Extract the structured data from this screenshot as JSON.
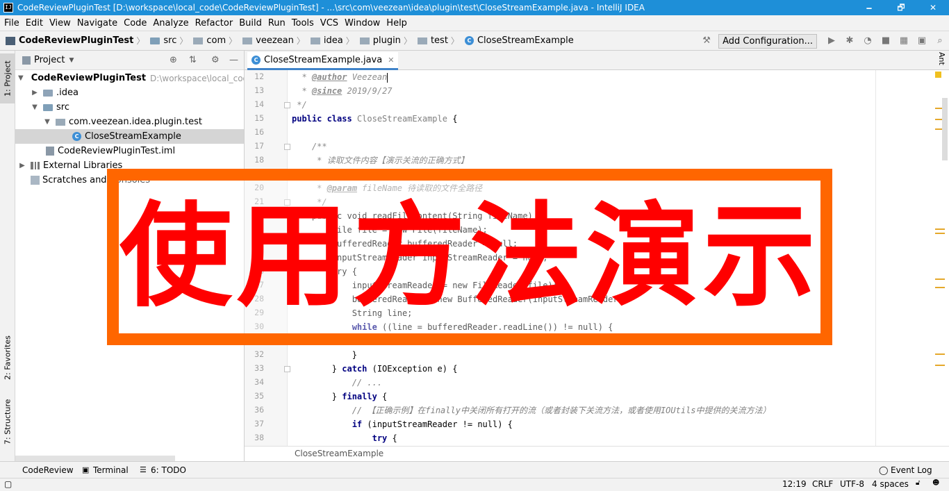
{
  "window": {
    "app_icon": "IJ",
    "title": "CodeReviewPluginTest [D:\\workspace\\local_code\\CodeReviewPluginTest] - ...\\src\\com\\veezean\\idea\\plugin\\test\\CloseStreamExample.java - IntelliJ IDEA",
    "minimize": "🗕",
    "maximize": "🗗",
    "close": "✕"
  },
  "menu": [
    "File",
    "Edit",
    "View",
    "Navigate",
    "Code",
    "Analyze",
    "Refactor",
    "Build",
    "Run",
    "Tools",
    "VCS",
    "Window",
    "Help"
  ],
  "breadcrumbs": [
    "CodeReviewPluginTest",
    "src",
    "com",
    "veezean",
    "idea",
    "plugin",
    "test",
    "CloseStreamExample"
  ],
  "toolbar": {
    "add_configuration": "Add Configuration..."
  },
  "left_strip": {
    "project_tab": "1: Project",
    "favorites_tab": "2: Favorites",
    "structure_tab": "7: Structure"
  },
  "project_panel": {
    "title": "Project",
    "tree": [
      {
        "label": "CodeReviewPluginTest",
        "extra": "D:\\workspace\\local_code"
      },
      {
        "label": ".idea"
      },
      {
        "label": "src"
      },
      {
        "label": "com.veezean.idea.plugin.test"
      },
      {
        "label": "CloseStreamExample"
      },
      {
        "label": "CodeReviewPluginTest.iml"
      },
      {
        "label": "External Libraries"
      },
      {
        "label": "Scratches and Consoles"
      }
    ]
  },
  "editor": {
    "tab_label": "CloseStreamExample.java",
    "line_numbers": [
      "12",
      "13",
      "14",
      "15",
      "16",
      "17",
      "18",
      "",
      "20",
      "21",
      "22",
      "23",
      "24",
      "25",
      "26",
      "27",
      "28",
      "29",
      "30",
      "",
      "32",
      "33",
      "34",
      "35",
      "36",
      "37",
      "38"
    ],
    "lines": {
      "l12_tag": "@author",
      "l12_text": " Veezean",
      "l13_tag": "@since",
      "l13_text": " 2019/9/27",
      "l14": " */",
      "l15_kw": "public class ",
      "l15_cls": "CloseStreamExample",
      "l15_rest": " {",
      "l17": "    /**",
      "l18": "     * 读取文件内容【演示关流的正确方式】",
      "l20_pre": "     * ",
      "l20_tag": "@param",
      "l20_rest": " fileName 待读取的文件全路径",
      "l21": "     */",
      "l22": "    public void readFileContent(String fileName) {",
      "l23": "        File file = new File(fileName);",
      "l24": "        BufferedReader bufferedReader = null;",
      "l25": "        InputStreamReader inputStreamReader = null;",
      "l26": "        try {",
      "l27": "            inputStreamReader = new FileReader(file);",
      "l28": "            bufferedReader = new BufferedReader(inputStreamReader);",
      "l29": "            String line;",
      "l30_kw": "            while",
      "l30_rest": " ((line = bufferedReader.readLine()) != null) {",
      "l32": "            }",
      "l33_pre": "        } ",
      "l33_kw": "catch",
      "l33_rest": " (IOException e) {",
      "l34": "            // ...",
      "l35_pre": "        } ",
      "l35_kw": "finally",
      "l35_rest": " {",
      "l36": "            // 【正确示例】在finally中关闭所有打开的流（或者封装下关流方法，或者使用IOUtils中提供的关流方法）",
      "l37_kw": "            if",
      "l37_rest": " (inputStreamReader != null) {",
      "l38_kw": "                try",
      "l38_rest": " {"
    },
    "breadcrumb": "CloseStreamExample"
  },
  "overlay_text": "使用方法演示",
  "right_strip": {
    "ant_tab": "Ant"
  },
  "bottom_tools": {
    "code_review": "CodeReview",
    "terminal": "Terminal",
    "todo": "6: TODO",
    "event_log": "Event Log"
  },
  "status": {
    "position": "12:19",
    "line_sep": "CRLF",
    "encoding": "UTF-8",
    "indent": "4 spaces"
  },
  "colors": {
    "titlebar": "#1e8fd8",
    "overlay_border": "#ff6600",
    "overlay_text": "#ff0000",
    "keyword": "#000080"
  }
}
